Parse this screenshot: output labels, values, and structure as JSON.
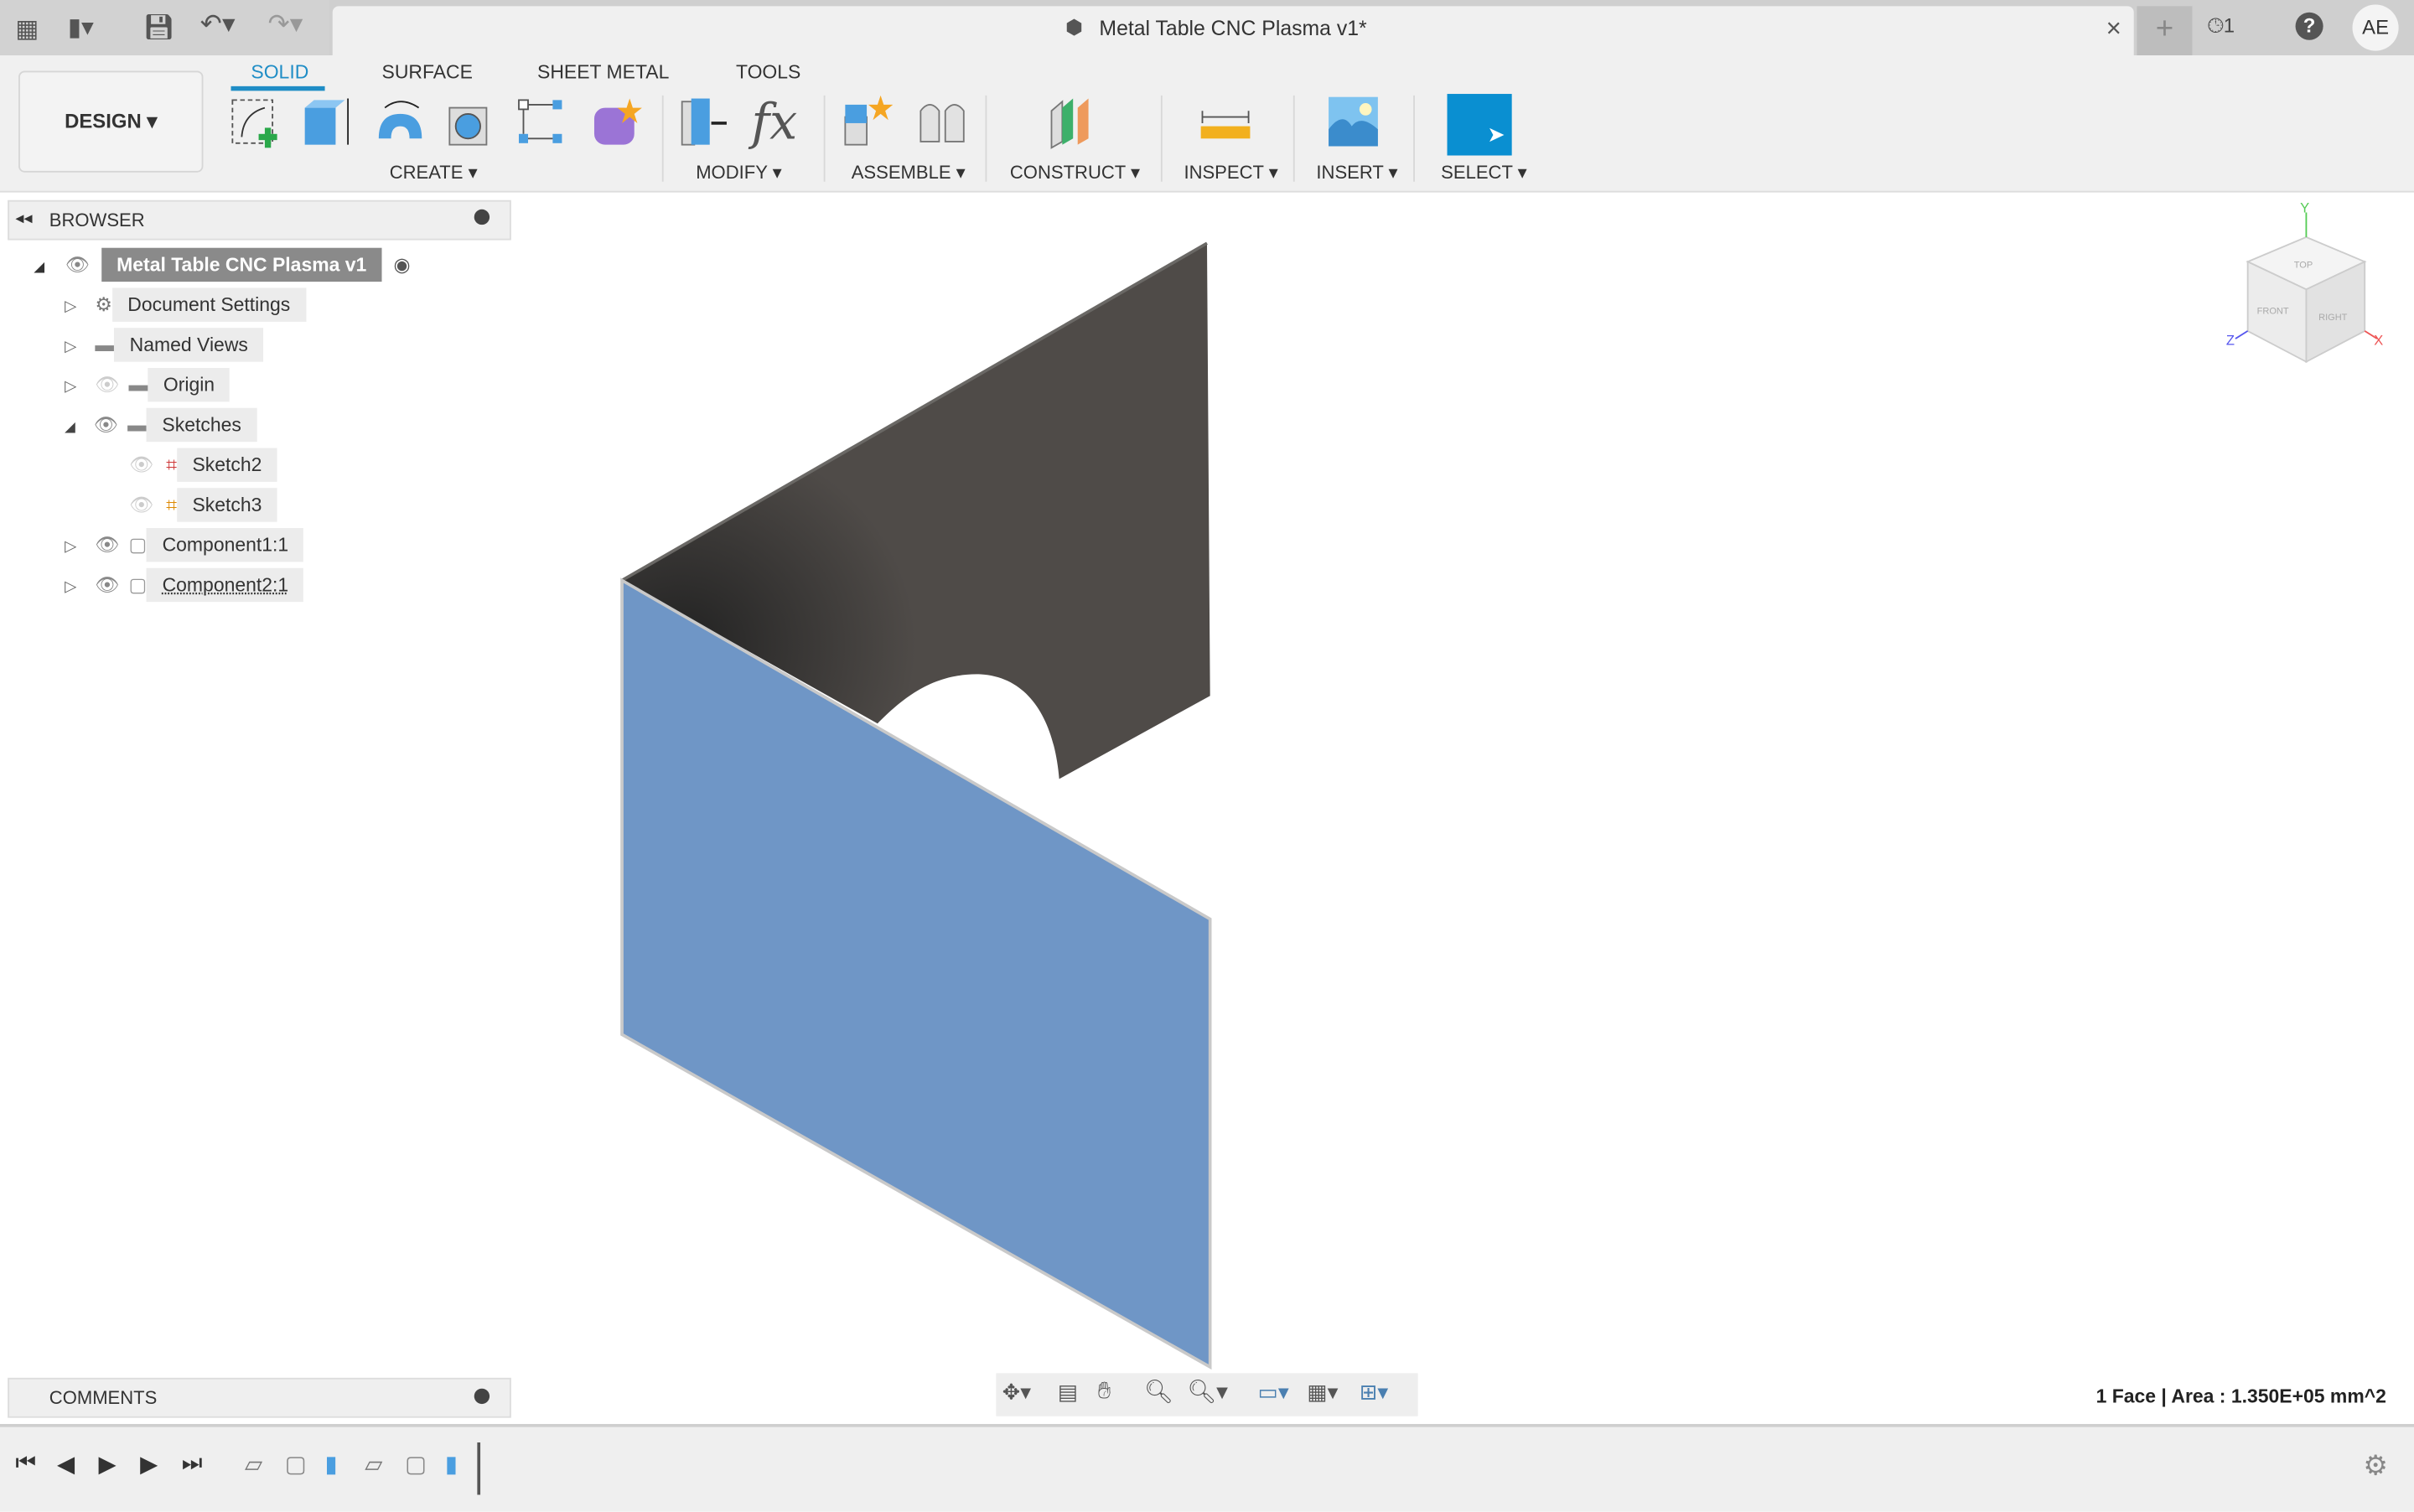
{
  "window": {
    "title": "Metal Table CNC Plasma v1*",
    "notifications_count": "1",
    "user_initials": "AE",
    "close": "×"
  },
  "workspace": {
    "label": "DESIGN ▾"
  },
  "ribbon": {
    "tabs": [
      {
        "label": "SOLID",
        "active": true
      },
      {
        "label": "SURFACE"
      },
      {
        "label": "SHEET METAL"
      },
      {
        "label": "TOOLS"
      }
    ],
    "groups": [
      {
        "label": "CREATE ▾"
      },
      {
        "label": "MODIFY ▾"
      },
      {
        "label": "ASSEMBLE ▾"
      },
      {
        "label": "CONSTRUCT ▾"
      },
      {
        "label": "INSPECT ▾"
      },
      {
        "label": "INSERT ▾"
      },
      {
        "label": "SELECT ▾"
      }
    ],
    "accent": "#1f8dc6"
  },
  "browser": {
    "title": "BROWSER",
    "root": "Metal Table CNC Plasma v1",
    "items": [
      {
        "label": "Document Settings"
      },
      {
        "label": "Named Views"
      },
      {
        "label": "Origin"
      },
      {
        "label": "Sketches"
      },
      {
        "label": "Sketch2"
      },
      {
        "label": "Sketch3"
      },
      {
        "label": "Component1:1"
      },
      {
        "label": "Component2:1"
      }
    ]
  },
  "comments": {
    "title": "COMMENTS"
  },
  "viewcube": {
    "top": "TOP",
    "front": "FRONT",
    "right": "RIGHT",
    "x": "X",
    "y": "Y",
    "z": "Z"
  },
  "status": {
    "text": "1 Face | Area : 1.350E+05 mm^2"
  },
  "colors": {
    "selected_face": "#6f96c6",
    "dark_face": "#4f4b48"
  }
}
